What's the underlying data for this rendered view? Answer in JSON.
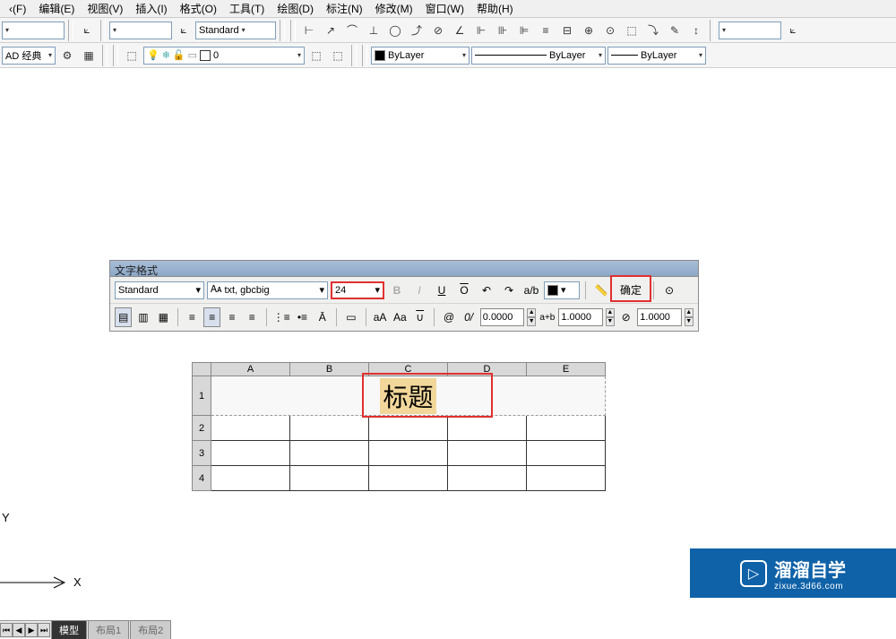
{
  "menu": {
    "file": "‹(F)",
    "edit": "编辑(E)",
    "view": "视图(V)",
    "insert": "插入(I)",
    "format": "格式(O)",
    "tools": "工具(T)",
    "draw": "绘图(D)",
    "annotate": "标注(N)",
    "modify": "修改(M)",
    "window": "窗口(W)",
    "help": "帮助(H)"
  },
  "toolbar": {
    "style_dd": "Standard",
    "workspace": "AD 经典",
    "layer_state": "0",
    "color_name": "ByLayer",
    "linetype": "ByLayer",
    "lineweight": "ByLayer"
  },
  "text_panel": {
    "title": "文字格式",
    "style": "Standard",
    "font": "txt, gbcbig",
    "size": "24",
    "ok": "确定",
    "tracking": "0.0000",
    "width_factor": "1.0000",
    "oblique": "1.0000",
    "btn_bold": "B",
    "btn_italic": "I",
    "btn_under": "U",
    "btn_over": "O",
    "btn_at": "@",
    "btn_zero": "0/",
    "btn_aib": "a+b",
    "btn_aA": "aA",
    "btn_Aa": "Aa"
  },
  "sheet": {
    "cols": [
      "A",
      "B",
      "C",
      "D",
      "E"
    ],
    "rows": [
      "1",
      "2",
      "3",
      "4"
    ],
    "title_text": "标题"
  },
  "ucs": {
    "x": "X",
    "y": "Y"
  },
  "tabs": {
    "model": "模型",
    "layout1": "布局1",
    "layout2": "布局2"
  },
  "watermark": {
    "main": "溜溜自学",
    "sub": "zixue.3d66.com",
    "icon": "▷"
  }
}
